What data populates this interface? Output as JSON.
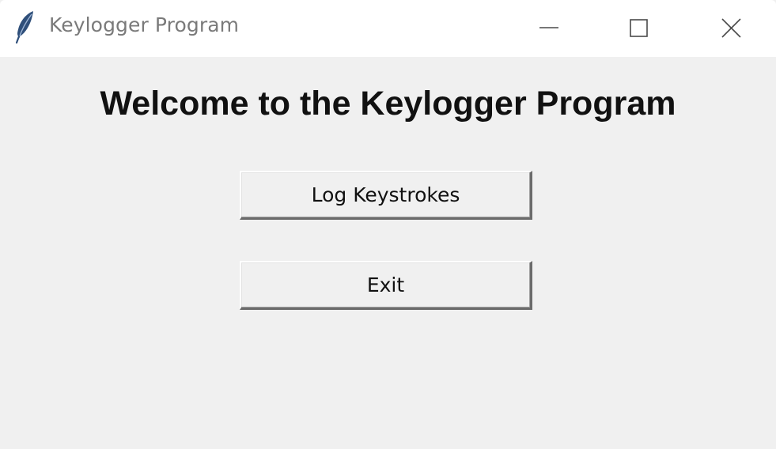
{
  "window": {
    "title": "Keylogger Program",
    "app_icon": "feather-icon",
    "controls": {
      "minimize_icon": "minimize-icon",
      "maximize_icon": "maximize-icon",
      "close_icon": "close-icon"
    }
  },
  "main": {
    "heading": "Welcome to the Keylogger Program",
    "buttons": {
      "log_label": "Log Keystrokes",
      "exit_label": "Exit"
    }
  },
  "colors": {
    "titlebar_bg": "#ffffff",
    "window_bg": "#f0f0f0",
    "title_text": "#7a7a7a",
    "heading_text": "#111111"
  }
}
